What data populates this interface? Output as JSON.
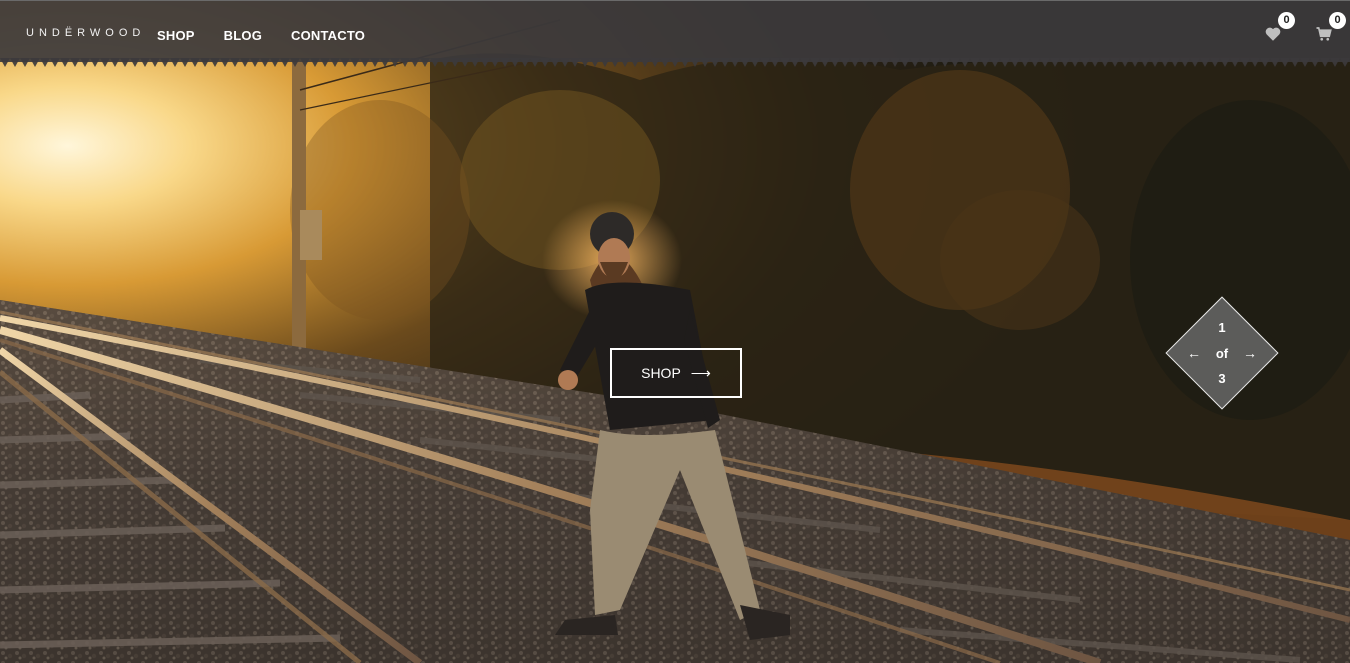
{
  "header": {
    "logo": "UNDËRWOOD",
    "nav": [
      {
        "label": "SHOP"
      },
      {
        "label": "BLOG"
      },
      {
        "label": "CONTACTO"
      }
    ],
    "wishlist_count": "0",
    "cart_count": "0"
  },
  "hero": {
    "cta_label": "SHOP",
    "cta_arrow": "⟶",
    "pager": {
      "current": "1",
      "of": "of",
      "total": "3",
      "prev": "←",
      "next": "→"
    }
  },
  "icons": {
    "wishlist": "heart-icon",
    "cart": "cart-icon"
  },
  "colors": {
    "header_bg": "#3c3a3c",
    "accent_light": "#ffffff"
  }
}
